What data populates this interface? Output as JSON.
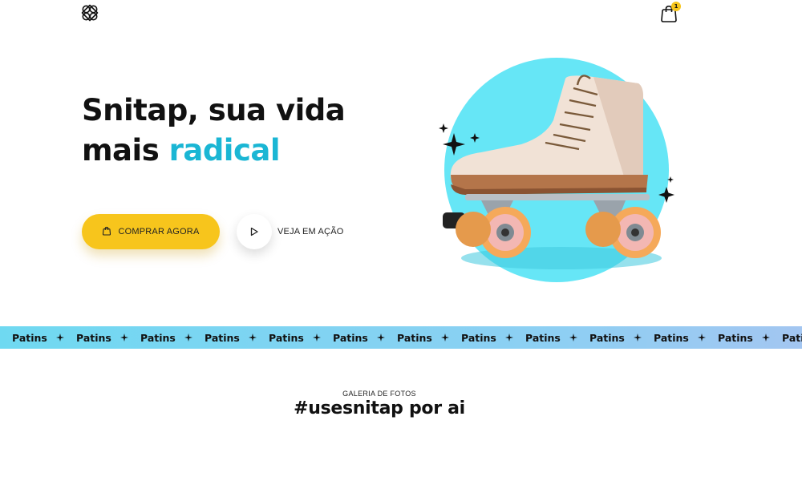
{
  "header": {
    "logo_icon": "snitap-logo-icon",
    "cart_icon": "shopping-bag-icon",
    "cart_count": "1"
  },
  "hero": {
    "title_line1": "Snitap, sua vida",
    "title_line2_plain": "mais ",
    "title_line2_accent": "radical",
    "buy_button": "COMPRAR AGORA",
    "buy_icon": "shopping-bag-icon",
    "play_icon": "play-icon",
    "watch_label": "VEJA EM AÇÃO",
    "image_alt": "roller-skate"
  },
  "ticker": {
    "word": "Patins",
    "separator_icon": "sparkle-icon"
  },
  "gallery": {
    "label": "GALERIA DE FOTOS",
    "title": "#usesnitap por ai"
  },
  "colors": {
    "accent": "#1ab6d4",
    "button": "#f7c51c",
    "circle": "#66e6f6",
    "ticker": "#6fd9f1"
  }
}
